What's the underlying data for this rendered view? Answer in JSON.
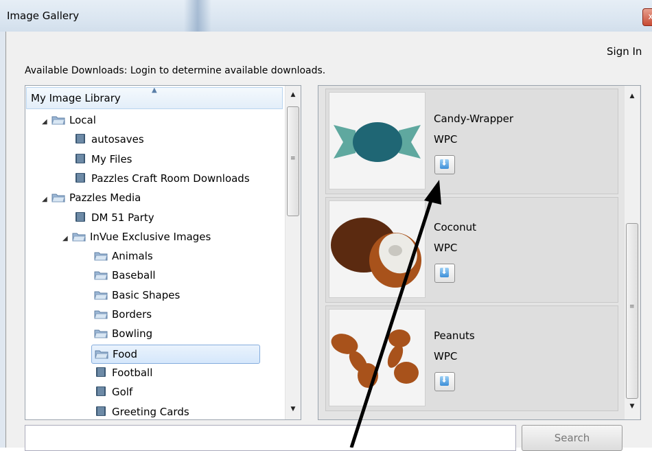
{
  "window": {
    "title": "Image Gallery",
    "close_glyph": "x"
  },
  "header": {
    "sign_in": "Sign In",
    "available_downloads": "Available Downloads: Login to determine available downloads."
  },
  "tree": {
    "root_label": "My Image Library",
    "nodes": [
      {
        "label": "Local",
        "expanded": true,
        "icon": "open-folder-icon"
      },
      {
        "label": "autosaves",
        "icon": "book-folder-icon"
      },
      {
        "label": "My Files",
        "icon": "book-folder-icon"
      },
      {
        "label": "Pazzles Craft Room Downloads",
        "icon": "book-folder-icon"
      },
      {
        "label": "Pazzles Media",
        "expanded": true,
        "icon": "open-folder-icon"
      },
      {
        "label": "DM 51 Party",
        "icon": "book-folder-icon"
      },
      {
        "label": "InVue Exclusive Images",
        "expanded": true,
        "icon": "open-folder-icon"
      },
      {
        "label": "Animals",
        "icon": "open-folder-icon"
      },
      {
        "label": "Baseball",
        "icon": "open-folder-icon"
      },
      {
        "label": "Basic Shapes",
        "icon": "open-folder-icon"
      },
      {
        "label": "Borders",
        "icon": "open-folder-icon"
      },
      {
        "label": "Bowling",
        "icon": "open-folder-icon"
      },
      {
        "label": "Food",
        "selected": true,
        "icon": "open-folder-icon"
      },
      {
        "label": "Football",
        "icon": "book-folder-icon"
      },
      {
        "label": "Golf",
        "icon": "book-folder-icon"
      },
      {
        "label": "Greeting Cards",
        "icon": "book-folder-icon"
      }
    ]
  },
  "gallery": {
    "items": [
      {
        "name": "Candy-Wrapper",
        "type": "WPC",
        "thumbnail": "candy-wrapper-image"
      },
      {
        "name": "Coconut",
        "type": "WPC",
        "thumbnail": "coconut-image"
      },
      {
        "name": "Peanuts",
        "type": "WPC",
        "thumbnail": "peanuts-image"
      }
    ]
  },
  "search": {
    "button_label": "Search",
    "value": ""
  },
  "colors": {
    "candy_body": "#1f6674",
    "candy_ends": "#5fa89f",
    "coconut_shell": "#5b2a10",
    "coconut_flesh": "#ecebe6",
    "peanut": "#a8521b",
    "selection": "#84acdd"
  }
}
